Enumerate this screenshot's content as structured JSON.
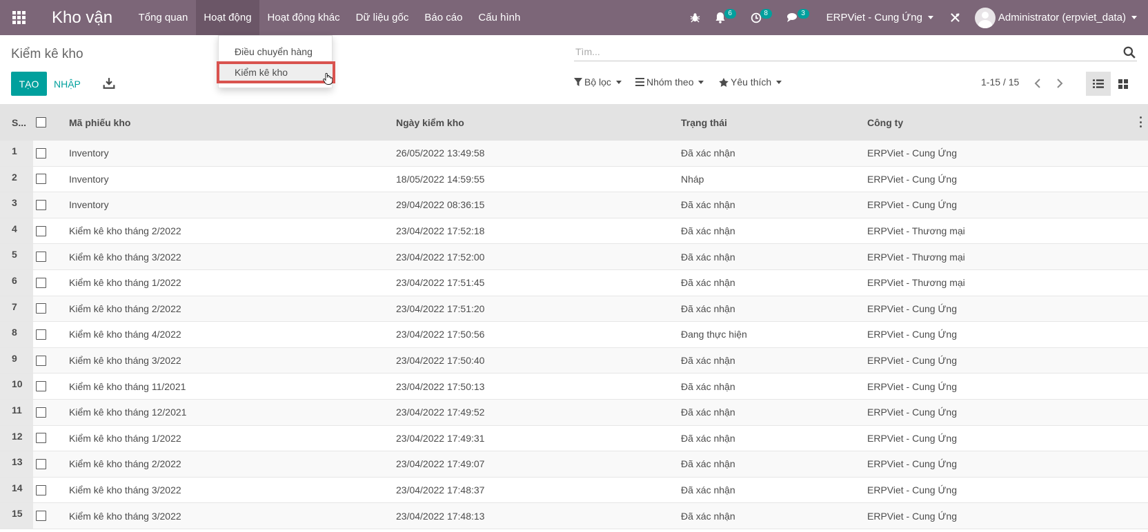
{
  "navbar": {
    "brand": "Kho vận",
    "menu": [
      "Tổng quan",
      "Hoạt động",
      "Hoạt động khác",
      "Dữ liệu gốc",
      "Báo cáo",
      "Cấu hình"
    ],
    "activities_badge": "6",
    "clock_badge": "8",
    "messages_badge": "3",
    "company": "ERPViet - Cung Ứng",
    "user": "Administrator (erpviet_data)"
  },
  "dropdown": {
    "items": [
      "Điều chuyển hàng",
      "Kiểm kê kho"
    ]
  },
  "control": {
    "title": "Kiểm kê kho",
    "create_label": "TẠO",
    "import_label": "NHẬP",
    "search_placeholder": "Tìm...",
    "filters_label": "Bộ lọc",
    "groupby_label": "Nhóm theo",
    "favorites_label": "Yêu thích",
    "pager": "1-15 / 15"
  },
  "table": {
    "headers": {
      "seq": "S...",
      "code": "Mã phiếu kho",
      "date": "Ngày kiểm kho",
      "state": "Trạng thái",
      "company": "Công ty"
    },
    "rows": [
      {
        "seq": "1",
        "code": "Inventory",
        "date": "26/05/2022 13:49:58",
        "state": "Đã xác nhận",
        "company": "ERPViet - Cung Ứng"
      },
      {
        "seq": "2",
        "code": "Inventory",
        "date": "18/05/2022 14:59:55",
        "state": "Nháp",
        "company": "ERPViet - Cung Ứng"
      },
      {
        "seq": "3",
        "code": "Inventory",
        "date": "29/04/2022 08:36:15",
        "state": "Đã xác nhận",
        "company": "ERPViet - Cung Ứng"
      },
      {
        "seq": "4",
        "code": "Kiểm kê kho tháng 2/2022",
        "date": "23/04/2022 17:52:18",
        "state": "Đã xác nhận",
        "company": "ERPViet - Thương mại"
      },
      {
        "seq": "5",
        "code": "Kiểm kê kho tháng 3/2022",
        "date": "23/04/2022 17:52:00",
        "state": "Đã xác nhận",
        "company": "ERPViet - Thương mại"
      },
      {
        "seq": "6",
        "code": "Kiểm kê kho tháng 1/2022",
        "date": "23/04/2022 17:51:45",
        "state": "Đã xác nhận",
        "company": "ERPViet - Thương mại"
      },
      {
        "seq": "7",
        "code": "Kiểm kê kho tháng 2/2022",
        "date": "23/04/2022 17:51:20",
        "state": "Đã xác nhận",
        "company": "ERPViet - Cung Ứng"
      },
      {
        "seq": "8",
        "code": "Kiểm kê kho tháng 4/2022",
        "date": "23/04/2022 17:50:56",
        "state": "Đang thực hiện",
        "company": "ERPViet - Cung Ứng"
      },
      {
        "seq": "9",
        "code": "Kiểm kê kho tháng 3/2022",
        "date": "23/04/2022 17:50:40",
        "state": "Đã xác nhận",
        "company": "ERPViet - Cung Ứng"
      },
      {
        "seq": "10",
        "code": "Kiểm kê kho tháng 11/2021",
        "date": "23/04/2022 17:50:13",
        "state": "Đã xác nhận",
        "company": "ERPViet - Cung Ứng"
      },
      {
        "seq": "11",
        "code": "Kiểm kê kho tháng 12/2021",
        "date": "23/04/2022 17:49:52",
        "state": "Đã xác nhận",
        "company": "ERPViet - Cung Ứng"
      },
      {
        "seq": "12",
        "code": "Kiểm kê kho tháng 1/2022",
        "date": "23/04/2022 17:49:31",
        "state": "Đã xác nhận",
        "company": "ERPViet - Cung Ứng"
      },
      {
        "seq": "13",
        "code": "Kiểm kê kho tháng 2/2022",
        "date": "23/04/2022 17:49:07",
        "state": "Đã xác nhận",
        "company": "ERPViet - Cung Ứng"
      },
      {
        "seq": "14",
        "code": "Kiểm kê kho tháng 3/2022",
        "date": "23/04/2022 17:48:37",
        "state": "Đã xác nhận",
        "company": "ERPViet - Cung Ứng"
      },
      {
        "seq": "15",
        "code": "Kiểm kê kho tháng 3/2022",
        "date": "23/04/2022 17:48:13",
        "state": "Đã xác nhận",
        "company": "ERPViet - Cung Ứng"
      }
    ]
  }
}
